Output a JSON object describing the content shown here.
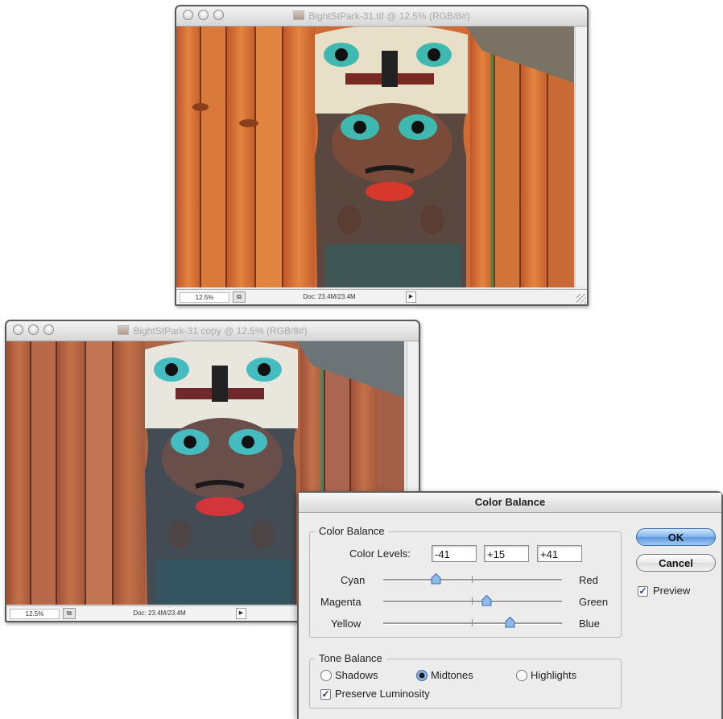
{
  "window1": {
    "title": "BightStPark-31.tif @ 12.5% (RGB/8#)",
    "zoom": "12.5%",
    "doc_info": "Doc: 23.4M/23.4M"
  },
  "window2": {
    "title": "BightStPark-31 copy @ 12.5% (RGB/8#)",
    "zoom": "12.5%",
    "doc_info": "Doc: 23.4M/23.4M"
  },
  "dialog": {
    "title": "Color Balance",
    "color_balance_group": "Color Balance",
    "color_levels_label": "Color Levels:",
    "levels": [
      "-41",
      "+15",
      "+41"
    ],
    "sliders": [
      {
        "left": "Cyan",
        "right": "Red",
        "value": -41
      },
      {
        "left": "Magenta",
        "right": "Green",
        "value": 15
      },
      {
        "left": "Yellow",
        "right": "Blue",
        "value": 41
      }
    ],
    "tone_balance_group": "Tone Balance",
    "tones": {
      "shadows": "Shadows",
      "midtones": "Midtones",
      "highlights": "Highlights"
    },
    "selected_tone": "Midtones",
    "preserve_luminosity": "Preserve Luminosity",
    "preserve_checked": true,
    "ok": "OK",
    "cancel": "Cancel",
    "preview": "Preview",
    "preview_checked": true
  },
  "colors": {
    "ok_button": "#6aa6e3",
    "check_mark": "#1b3f88"
  }
}
